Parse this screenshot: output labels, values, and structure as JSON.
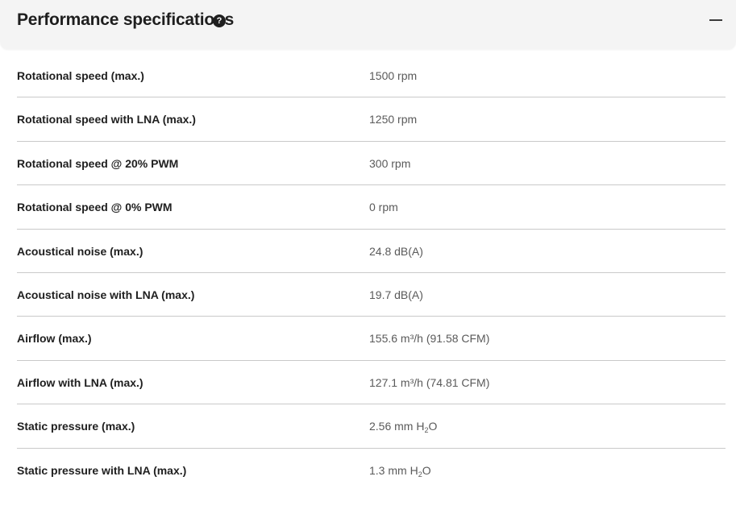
{
  "section": {
    "title": "Performance specifications",
    "help_icon": "question-circle-icon",
    "help_glyph": "?",
    "collapse_icon": "minus-icon"
  },
  "specs": [
    {
      "label": "Rotational speed (max.)",
      "value": "1500 rpm"
    },
    {
      "label": "Rotational speed with LNA (max.)",
      "value": "1250 rpm"
    },
    {
      "label": "Rotational speed @ 20% PWM",
      "value": "300 rpm"
    },
    {
      "label": "Rotational speed @ 0% PWM",
      "value": "0 rpm"
    },
    {
      "label": "Acoustical noise (max.)",
      "value": "24.8 dB(A)"
    },
    {
      "label": "Acoustical noise with LNA (max.)",
      "value": "19.7 dB(A)"
    },
    {
      "label": "Airflow (max.)",
      "value": "155.6 m³/h (91.58 CFM)"
    },
    {
      "label": "Airflow with LNA (max.)",
      "value": "127.1 m³/h (74.81 CFM)"
    },
    {
      "label": "Static pressure (max.)",
      "value_pre": "2.56 mm H",
      "value_sub": "2",
      "value_post": "O"
    },
    {
      "label": "Static pressure with LNA (max.)",
      "value_pre": "1.3 mm H",
      "value_sub": "2",
      "value_post": "O"
    }
  ],
  "colors": {
    "header_bg": "#f4f4f4",
    "label": "#202020",
    "value": "#5a5a5a",
    "divider": "#c9c9c9"
  }
}
